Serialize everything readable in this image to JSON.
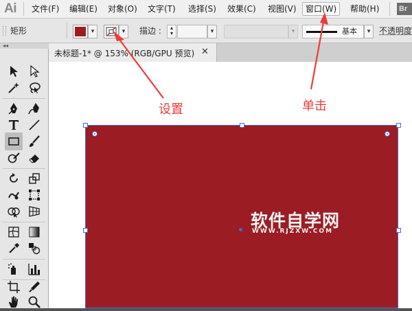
{
  "app": {
    "logo": "Ai",
    "bridge_label": "Br"
  },
  "menu": [
    {
      "label": "文件(F)",
      "active": false
    },
    {
      "label": "编辑(E)",
      "active": false
    },
    {
      "label": "对象(O)",
      "active": false
    },
    {
      "label": "文字(T)",
      "active": false
    },
    {
      "label": "选择(S)",
      "active": false
    },
    {
      "label": "效果(C)",
      "active": false
    },
    {
      "label": "视图(V)",
      "active": false
    },
    {
      "label": "窗口(W)",
      "active": true
    },
    {
      "label": "帮助(H)",
      "active": false
    }
  ],
  "control_bar": {
    "object_type": "矩形",
    "fill_color": "#9b1c23",
    "stroke_color": "none",
    "stroke_label": "描边 :",
    "stroke_weight": "",
    "stroke_profile": "基本",
    "opacity_label": "不透明度"
  },
  "tools": [
    "selection-icon",
    "direct-selection-icon",
    "magic-wand-icon",
    "lasso-icon",
    "pen-icon",
    "curvature-icon",
    "type-icon",
    "line-segment-icon",
    "rectangle-icon",
    "paintbrush-icon",
    "shaper-icon",
    "eraser-icon",
    "rotate-icon",
    "scale-icon",
    "warp-icon",
    "free-transform-icon",
    "shape-builder-icon",
    "perspective-grid-icon",
    "mesh-icon",
    "gradient-icon",
    "eyedropper-icon",
    "blend-icon",
    "symbol-sprayer-icon",
    "column-graph-icon",
    "artboard-icon",
    "slice-icon",
    "hand-icon",
    "zoom-icon"
  ],
  "document": {
    "tab_title": "未标题-1* @ 153% (RGB/GPU 预览)",
    "close_glyph": "✕"
  },
  "artwork": {
    "fill": "#9b1c23",
    "selection_color": "#4a66d8",
    "watermark": "软件自学网",
    "watermark_url": "WWW.RJZXW.COM"
  },
  "annotations": {
    "set_label": "设置",
    "click_label": "单击",
    "color": "#ee3b3b"
  }
}
